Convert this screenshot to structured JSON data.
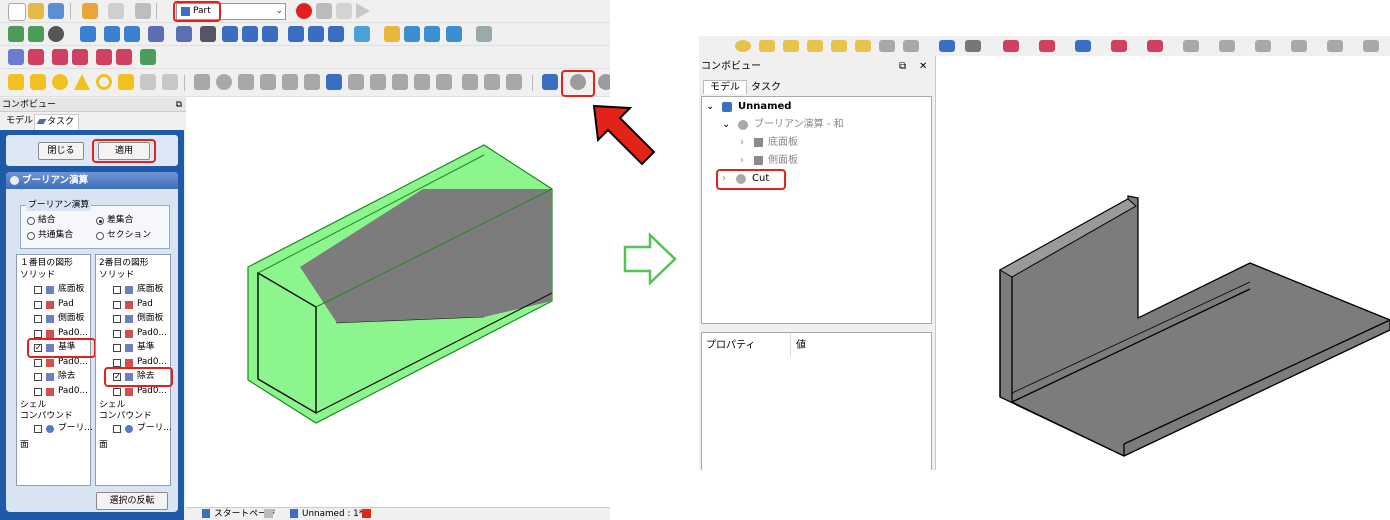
{
  "left": {
    "workbench_select": "Part",
    "combo_view_title": "コンボビュー",
    "tabs": [
      "モデル",
      "タスク"
    ],
    "buttons": {
      "close": "閉じる",
      "apply": "適用",
      "invert": "選択の反転"
    },
    "boolean_title": "ブーリアン演算",
    "operation_group_title": "ブーリアン演算",
    "operations": {
      "union": "結合",
      "difference": "差集合",
      "intersection": "共通集合",
      "section": "セクション"
    },
    "selected_operation": "difference",
    "first_shape": {
      "header": "１番目の図形",
      "solids_label": "ソリッド",
      "items": [
        {
          "label": "底面板",
          "checked": false
        },
        {
          "label": "Pad",
          "checked": false
        },
        {
          "label": "側面板",
          "checked": false
        },
        {
          "label": "Pad0...",
          "checked": false
        },
        {
          "label": "基準",
          "checked": true
        },
        {
          "label": "Pad0...",
          "checked": false
        },
        {
          "label": "除去",
          "checked": false
        },
        {
          "label": "Pad0...",
          "checked": false
        }
      ],
      "shells_label": "シェル",
      "compounds_label": "コンパウンド",
      "compound_item": "ブーリ...",
      "faces_label": "面"
    },
    "second_shape": {
      "header": "2番目の図形",
      "solids_label": "ソリッド",
      "items": [
        {
          "label": "底面板",
          "checked": false
        },
        {
          "label": "Pad",
          "checked": false
        },
        {
          "label": "側面板",
          "checked": false
        },
        {
          "label": "Pad0...",
          "checked": false
        },
        {
          "label": "基準",
          "checked": false
        },
        {
          "label": "Pad0...",
          "checked": false
        },
        {
          "label": "除去",
          "checked": true
        },
        {
          "label": "Pad0...",
          "checked": false
        }
      ],
      "shells_label": "シェル",
      "compounds_label": "コンパウンド",
      "compound_item": "ブーリ...",
      "faces_label": "面"
    },
    "bottom_tabs": [
      "スタートページ",
      "Unnamed : 1*"
    ]
  },
  "right": {
    "combo_view_title": "コンボビュー",
    "tabs": [
      "モデル",
      "タスク"
    ],
    "tree": {
      "root": "Unnamed",
      "boolean": "ブーリアン演算 - 和",
      "children": [
        "底面板",
        "側面板"
      ],
      "cut": "Cut"
    },
    "property_header": "プロパティ",
    "value_header": "値"
  },
  "colors": {
    "highlight": "#e2231a",
    "selection_green": "#8df58d",
    "solid_gray": "#7c7c7c",
    "task_blue": "#1e5aa8"
  }
}
